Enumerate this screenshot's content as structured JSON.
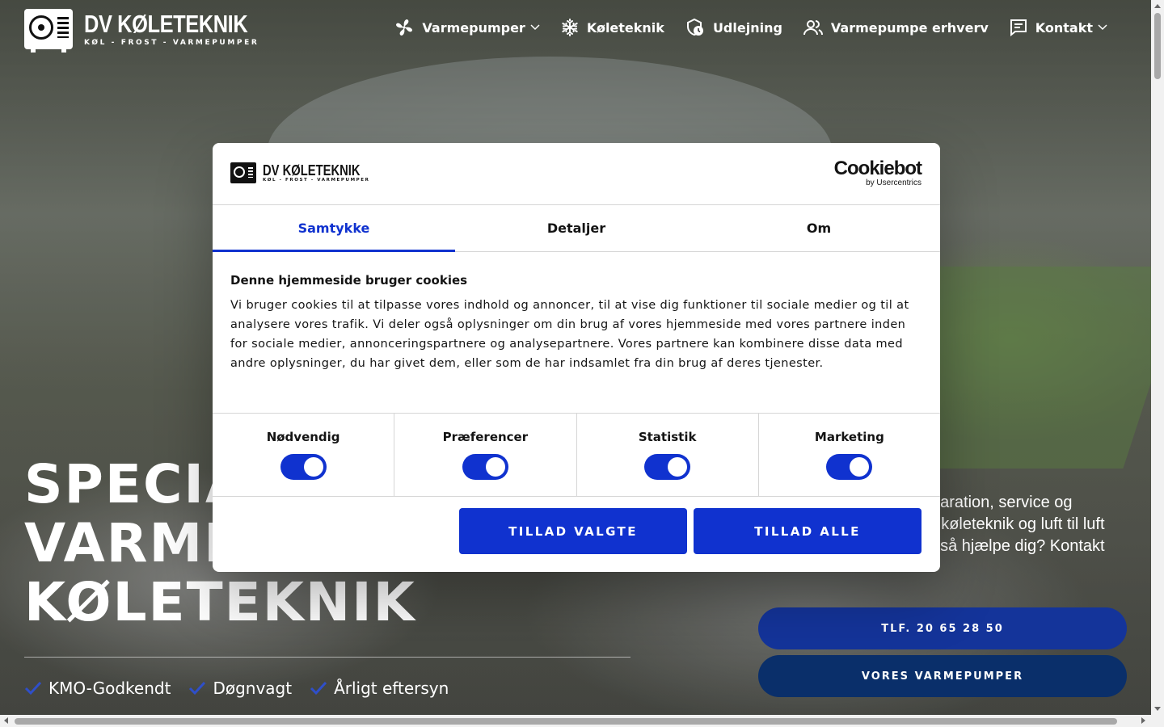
{
  "site": {
    "logo_name": "DV KØLETEKNIK",
    "logo_tagline": "KØL - FROST - VARMEPUMPER"
  },
  "nav": {
    "items": [
      {
        "label": "Varmepumper",
        "icon": "fan-icon",
        "dropdown": true
      },
      {
        "label": "Køleteknik",
        "icon": "snowflake-icon",
        "dropdown": false
      },
      {
        "label": "Udlejning",
        "icon": "shield-rental-icon",
        "dropdown": false
      },
      {
        "label": "Varmepumpe erhverv",
        "icon": "people-icon",
        "dropdown": false
      },
      {
        "label": "Kontakt",
        "icon": "chat-icon",
        "dropdown": true
      }
    ]
  },
  "hero": {
    "title_lines": [
      "SPECIA",
      "VARME",
      "KØLETEKNIK"
    ],
    "description": "paration, service og\nr køleteknik og luft til luft\ngså hjælpe dig? Kontakt",
    "usps": [
      "KMO-Godkendt",
      "Døgnvagt",
      "Årligt eftersyn"
    ],
    "cta_phone": "TLF. 20 65 28 50",
    "cta_pumps": "VORES VARMEPUMPER"
  },
  "cookie_dialog": {
    "brand": "Cookiebot",
    "brand_sub": "by Usercentrics",
    "tabs": [
      "Samtykke",
      "Detaljer",
      "Om"
    ],
    "active_tab": "Samtykke",
    "heading": "Denne hjemmeside bruger cookies",
    "body": "Vi bruger cookies til at tilpasse vores indhold og annoncer, til at vise dig funktioner til sociale medier og til at analysere vores trafik. Vi deler også oplysninger om din brug af vores hjemmeside med vores partnere inden for sociale medier, annonceringspartnere og analysepartnere. Vores partnere kan kombinere disse data med andre oplysninger, du har givet dem, eller som de har indsamlet fra din brug af deres tjenester.",
    "toggles": [
      {
        "label": "Nødvendig",
        "on": true
      },
      {
        "label": "Præferencer",
        "on": true
      },
      {
        "label": "Statistik",
        "on": true
      },
      {
        "label": "Marketing",
        "on": true
      }
    ],
    "btn_selected": "TILLAD VALGTE",
    "btn_all": "TILLAD ALLE"
  },
  "colors": {
    "accent": "#1032cf",
    "cta_phone": "#14349a",
    "cta_pumps": "#0a2f6a"
  }
}
